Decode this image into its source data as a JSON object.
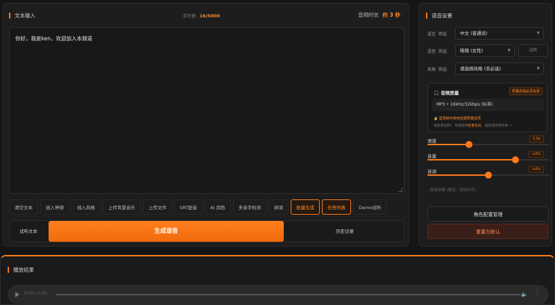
{
  "text_input": {
    "title": "文本输入",
    "char_count_label": "字符数",
    "char_count_value": "16/5000",
    "duration_label": "音频时长",
    "duration_value": "约 3 秒",
    "content": "你好，我是ken，欢迎加入本频道"
  },
  "toolbar": [
    {
      "label": "清空文本",
      "accent": false
    },
    {
      "label": "插入停顿",
      "accent": false
    },
    {
      "label": "插入风格",
      "accent": false
    },
    {
      "label": "上传背景音乐",
      "accent": false
    },
    {
      "label": "上传文件",
      "accent": false
    },
    {
      "label": "SRT配音",
      "accent": false
    },
    {
      "label": "AI 润色",
      "accent": false
    },
    {
      "label": "多音字检测",
      "accent": false
    },
    {
      "label": "拼读",
      "accent": false
    },
    {
      "label": "批量生成",
      "accent": true
    },
    {
      "label": "任务列表",
      "accent": true
    },
    {
      "label": "Demo试听",
      "accent": false
    }
  ],
  "actions": {
    "sample_label": "试听文本",
    "generate_label": "生成语音",
    "history_label": "历史记录"
  },
  "voice_settings": {
    "title": "语音设置",
    "language": {
      "label": "语言",
      "sub": "筛选",
      "value": "中文 (普通话)"
    },
    "voice": {
      "label": "语音",
      "sub": "筛选",
      "value": "晓晓 (女性)",
      "listen_label": "试听"
    },
    "style": {
      "label": "风格",
      "sub": "筛选",
      "value": "请选择风格 (非必选)"
    },
    "quality": {
      "title": "音频质量",
      "badge": "质量高端会员免费",
      "value": "MP3 • 16kHz/32kbps (标准)",
      "lock_text": "登录西可使用音频质量选项",
      "hint_prefix": "语音质包制？ 免费使用",
      "hint_highlight": "批量生成",
      "hint_suffix": "，速度提供更高档 →"
    },
    "sliders": [
      {
        "label": "语速",
        "value_text": "1.0x",
        "level": 0.34
      },
      {
        "label": "音量",
        "value_text": "+0%",
        "level": 0.72
      },
      {
        "label": "音调",
        "value_text": "+0%",
        "level": 0.5
      }
    ],
    "advanced_label": "› 高级参数 (静音 · 目标时长)",
    "role_button": "角色配置管理",
    "reset_button": "重置为默认"
  },
  "result": {
    "title": "播放结果",
    "time": "0:00 / 0:00"
  },
  "colors": {
    "accent": "#ff7a1a",
    "background": "#151515",
    "panel": "#1d1d1d"
  }
}
